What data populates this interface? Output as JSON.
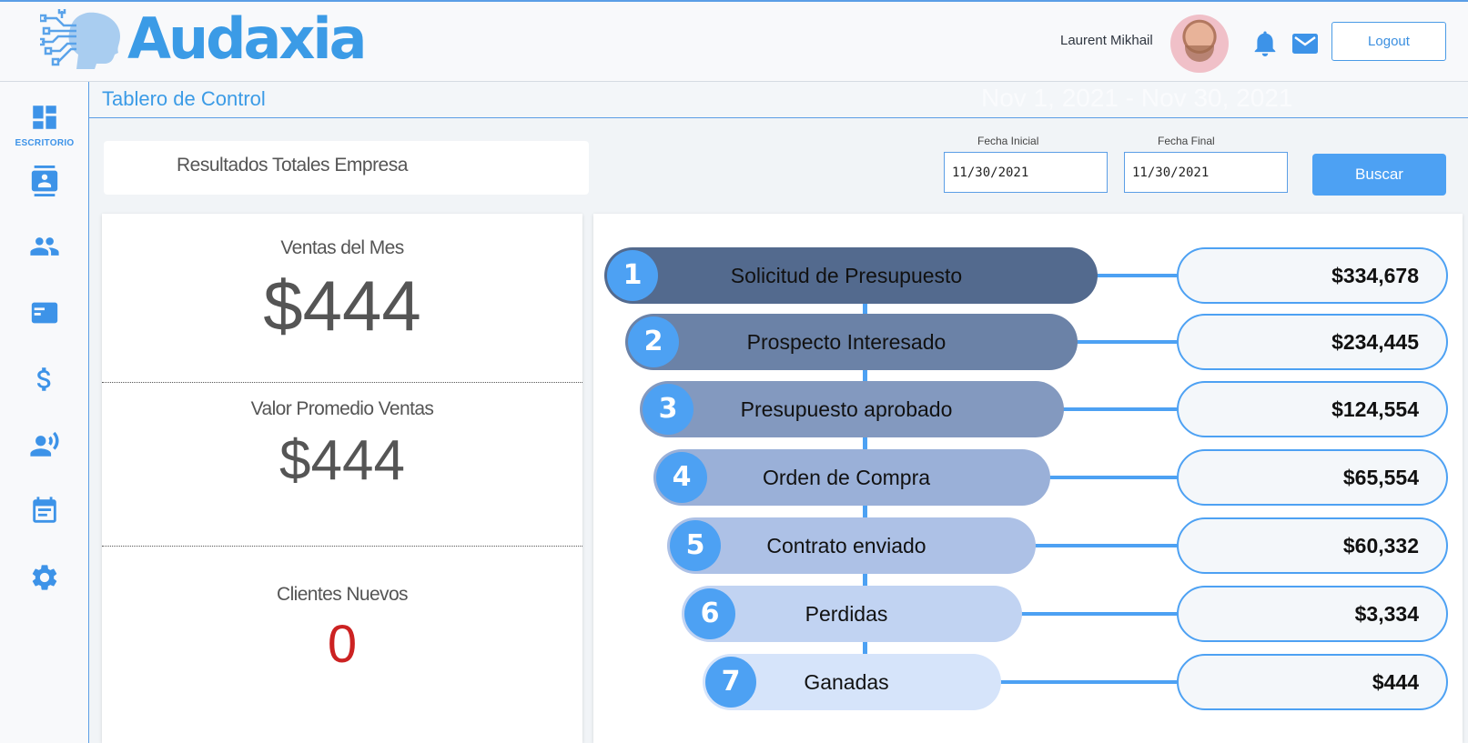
{
  "brand": {
    "name": "Audaxia",
    "color": "#3b9be6"
  },
  "header": {
    "user_name": "Laurent Mikhail",
    "logout_label": "Logout",
    "icons": [
      "bell-icon",
      "mail-icon"
    ]
  },
  "sidebar": {
    "items": [
      {
        "icon": "dashboard-icon",
        "label": "ESCRITORIO"
      },
      {
        "icon": "contact-card-icon",
        "label": ""
      },
      {
        "icon": "people-icon",
        "label": ""
      },
      {
        "icon": "card-icon",
        "label": ""
      },
      {
        "icon": "dollar-icon",
        "label": ""
      },
      {
        "icon": "voice-user-icon",
        "label": ""
      },
      {
        "icon": "calendar-note-icon",
        "label": ""
      },
      {
        "icon": "gear-icon",
        "label": ""
      }
    ]
  },
  "page": {
    "title": "Tablero de Control",
    "faint_date_range": "Nov 1, 2021 - Nov 30, 2021"
  },
  "filters": {
    "company_label": "Resultados Totales Empresa",
    "start_label": "Fecha Inicial",
    "start_value": "11/30/2021",
    "end_label": "Fecha Final",
    "end_value": "11/30/2021",
    "search_label": "Buscar"
  },
  "stats": {
    "sales_month_label": "Ventas del Mes",
    "sales_month_value": "$444",
    "avg_sales_label": "Valor Promedio Ventas",
    "avg_sales_value": "$444",
    "new_clients_label": "Clientes Nuevos",
    "new_clients_value": "0",
    "new_clients_color": "#cc2222"
  },
  "funnel": {
    "accent": "#4da1f3",
    "stages": [
      {
        "num": "1",
        "label": "Solicitud de Presupuesto",
        "value": "$334,678",
        "color": "#536a8e"
      },
      {
        "num": "2",
        "label": "Prospecto Interesado",
        "value": "$234,445",
        "color": "#6b82a7"
      },
      {
        "num": "3",
        "label": "Presupuesto aprobado",
        "value": "$124,554",
        "color": "#8399bf"
      },
      {
        "num": "4",
        "label": "Orden de Compra",
        "value": "$65,554",
        "color": "#9ab0d8"
      },
      {
        "num": "5",
        "label": "Contrato enviado",
        "value": "$60,332",
        "color": "#adc1e6"
      },
      {
        "num": "6",
        "label": "Perdidas",
        "value": "$3,334",
        "color": "#c1d3f2"
      },
      {
        "num": "7",
        "label": "Ganadas",
        "value": "$444",
        "color": "#d6e4fa"
      }
    ]
  }
}
